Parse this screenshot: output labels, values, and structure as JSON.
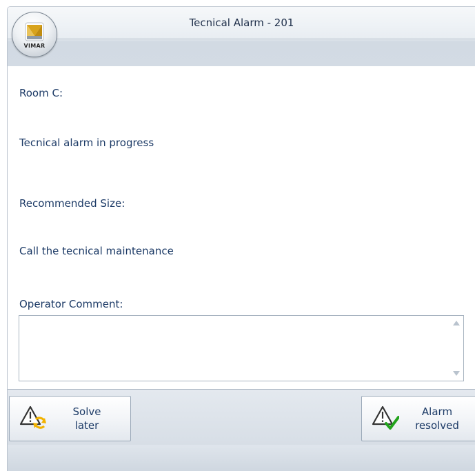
{
  "window": {
    "title": "Tecnical Alarm - 201",
    "logo_text": "VIMAR"
  },
  "content": {
    "room_label": "Room C:",
    "alarm_status": "Tecnical alarm in progress",
    "recommended_label": "Recommended Size:",
    "recommended_action": "Call the tecnical maintenance",
    "comment_label": "Operator Comment:",
    "comment_value": ""
  },
  "buttons": {
    "solve_later": "Solve\nlater",
    "alarm_resolved": "Alarm\nresolved"
  },
  "icons": {
    "app_logo": "vimar-logo-icon",
    "solve_later": "warning-refresh-icon",
    "alarm_resolved": "warning-check-icon",
    "scroll_up": "scroll-up-arrow-icon",
    "scroll_down": "scroll-down-arrow-icon"
  },
  "colors": {
    "text": "#1c3a66",
    "refresh_accent": "#f2b200",
    "check_accent": "#22a31c",
    "logo_accent": "#d8a31c"
  }
}
